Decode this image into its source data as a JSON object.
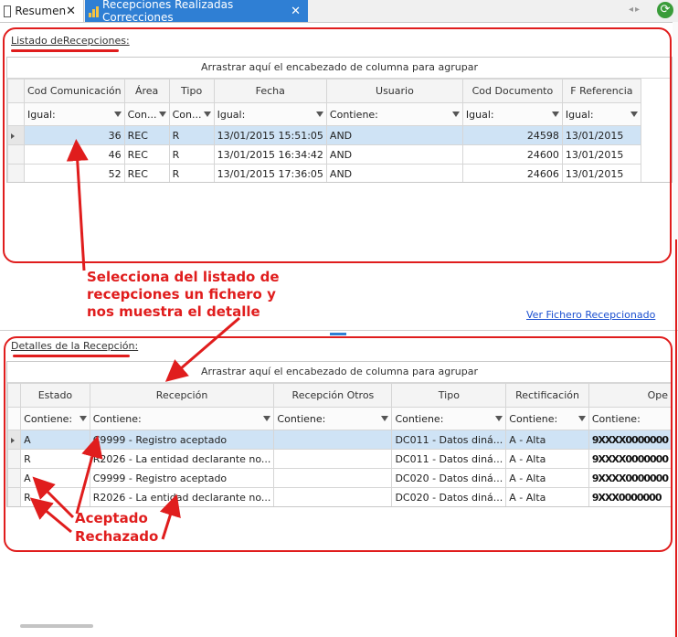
{
  "tabs": [
    {
      "label": "Resumen",
      "close": "✕"
    },
    {
      "label": "Recepciones Realizadas Correcciones",
      "close": "✕"
    }
  ],
  "top_section": {
    "label": "Listado deRecepciones:",
    "group_hint": "Arrastrar aquí el encabezado de columna para agrupar",
    "columns": [
      "Cod Comunicación",
      "Área",
      "Tipo",
      "Fecha",
      "Usuario",
      "Cod Documento",
      "F Referencia"
    ],
    "filters": [
      "Igual:",
      "Con...",
      "Con...",
      "Igual:",
      "Contiene:",
      "Igual:",
      "Igual:"
    ],
    "rows": [
      [
        "36",
        "REC",
        "R",
        "13/01/2015 15:51:05",
        "AND",
        "24598",
        "13/01/2015"
      ],
      [
        "46",
        "REC",
        "R",
        "13/01/2015 16:34:42",
        "AND",
        "24600",
        "13/01/2015"
      ],
      [
        "52",
        "REC",
        "R",
        "13/01/2015 17:36:05",
        "AND",
        "24606",
        "13/01/2015"
      ]
    ]
  },
  "link": "Ver Fichero Recepcionado",
  "bottom_section": {
    "label": "Detalles de la Recepción:",
    "group_hint": "Arrastrar aquí el encabezado de columna para agrupar",
    "columns": [
      "Estado",
      "Recepción",
      "Recepción Otros",
      "Tipo",
      "Rectificación",
      "Ope"
    ],
    "filters": [
      "Contiene:",
      "Contiene:",
      "Contiene:",
      "Contiene:",
      "Contiene:",
      "Contiene:"
    ],
    "rows": [
      [
        "A",
        "C9999 - Registro aceptado",
        "",
        "DC011 - Datos diná...",
        "A - Alta",
        "9XXXX0000000"
      ],
      [
        "R",
        "R2026 - La entidad declarante no...",
        "",
        "DC011 - Datos diná...",
        "A - Alta",
        "9XXXX0000000"
      ],
      [
        "A",
        "C9999 - Registro aceptado",
        "",
        "DC020 - Datos diná...",
        "A - Alta",
        "9XXXX0000000"
      ],
      [
        "R",
        "R2026 - La entidad declarante no...",
        "",
        "DC020 - Datos diná...",
        "A - Alta",
        "9XXX0000000"
      ]
    ]
  },
  "annotations": {
    "select_note": [
      "Selecciona del listado de",
      "recepciones un fichero y",
      "nos muestra el detalle"
    ],
    "accepted": "Aceptado",
    "rejected": "Rechazado"
  },
  "colors": {
    "accent": "#2f7fd4",
    "annotation": "#e01d1d",
    "selected_row": "#cfe3f5"
  }
}
